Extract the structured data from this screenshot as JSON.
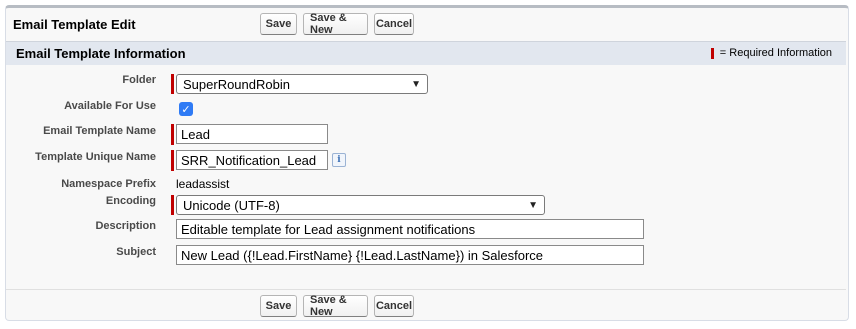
{
  "header": {
    "title": "Email Template Edit"
  },
  "buttons": {
    "save": "Save",
    "save_new": "Save & New",
    "cancel": "Cancel"
  },
  "section": {
    "title": "Email Template Information",
    "required_legend": "= Required Information"
  },
  "fields": {
    "folder": {
      "label": "Folder",
      "value": "SuperRoundRobin"
    },
    "available": {
      "label": "Available For Use",
      "checked": true
    },
    "template_name": {
      "label": "Email Template Name",
      "value": "Lead"
    },
    "unique_name": {
      "label": "Template Unique Name",
      "value": "SRR_Notification_Lead"
    },
    "namespace": {
      "label": "Namespace Prefix",
      "value": "leadassist"
    },
    "encoding": {
      "label": "Encoding",
      "value": "Unicode (UTF-8)"
    },
    "description": {
      "label": "Description",
      "value": "Editable template for Lead assignment notifications"
    },
    "subject": {
      "label": "Subject",
      "value": "New Lead ({!Lead.FirstName} {!Lead.LastName}) in Salesforce"
    }
  },
  "colors": {
    "required": "#c00000",
    "checkbox": "#2f7bf5",
    "section_bg": "#e2e7ef"
  }
}
